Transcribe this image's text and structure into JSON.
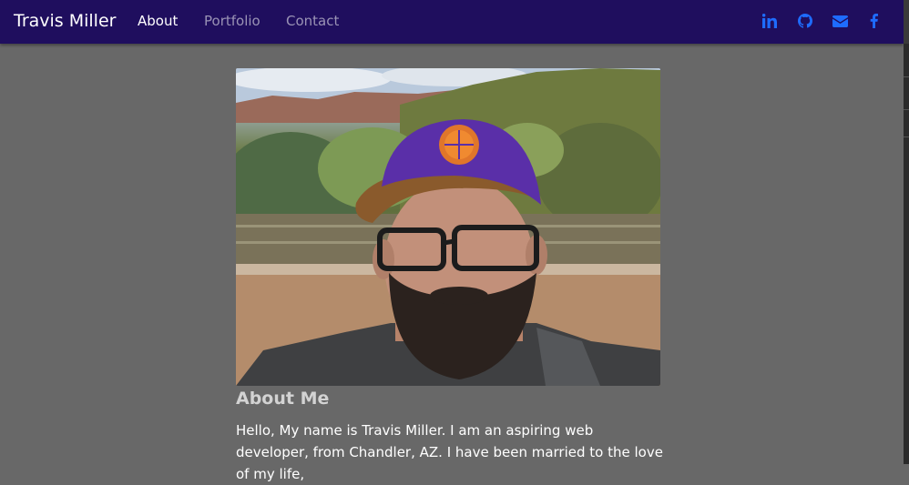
{
  "navbar": {
    "brand": "Travis Miller",
    "links": [
      {
        "label": "About",
        "active": true
      },
      {
        "label": "Portfolio",
        "active": false
      },
      {
        "label": "Contact",
        "active": false
      }
    ],
    "social": [
      {
        "icon": "linkedin-icon"
      },
      {
        "icon": "github-icon"
      },
      {
        "icon": "envelope-icon"
      },
      {
        "icon": "facebook-icon"
      }
    ]
  },
  "about": {
    "heading": "About Me",
    "paragraph": "Hello, My name is Travis Miller. I am an aspiring web developer, from Chandler, AZ. I have been married to the love of my life,"
  },
  "colors": {
    "navbar_bg": "#1f0e5e",
    "page_bg": "#686868",
    "social_icon": "#1e6cff",
    "heading": "#d3d3d3"
  }
}
